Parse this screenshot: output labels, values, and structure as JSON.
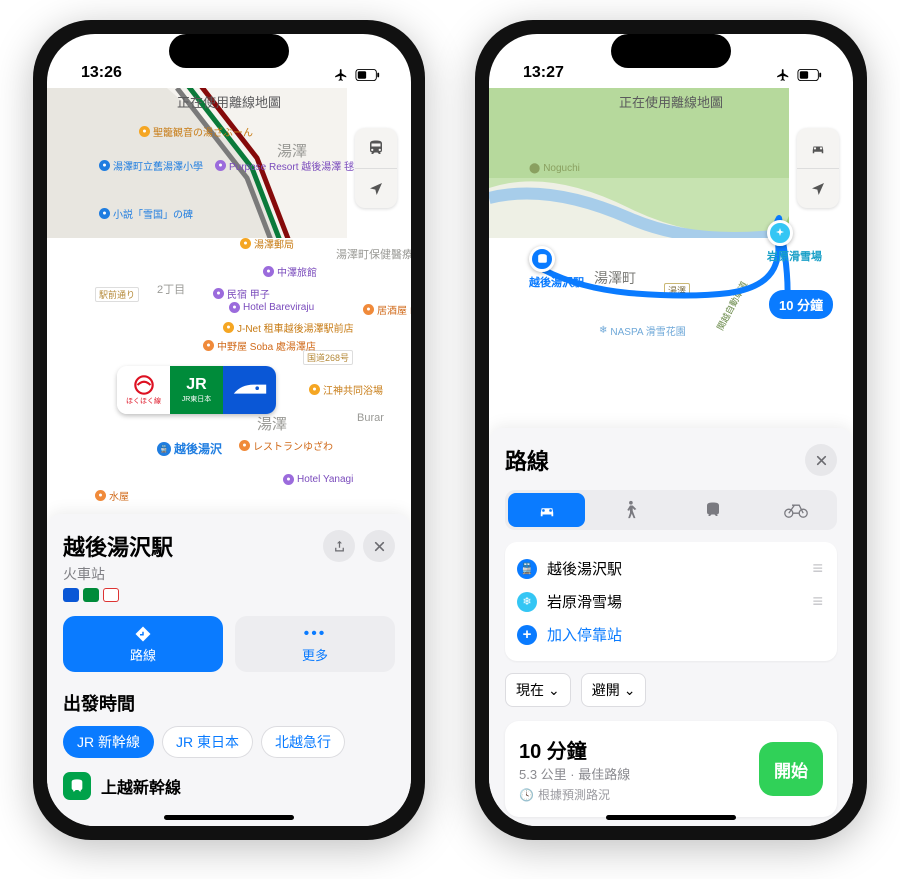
{
  "left": {
    "status_time": "13:26",
    "offline_banner": "正在使用離線地圖",
    "map": {
      "areas": [
        "湯澤",
        "湯澤",
        "2丁目"
      ],
      "station_label": "越後湯沢",
      "roads": [
        "駅前通り",
        "国道268号"
      ],
      "pois": [
        {
          "t": "shop",
          "name": "聖籠観音の湯ざぶーん"
        },
        {
          "t": "transit",
          "name": "湯澤町立舊湯澤小學"
        },
        {
          "t": "hotel",
          "name": "Purpose Resort 越後湯澤 毬"
        },
        {
          "t": "transit",
          "name": "小説「雪国」の碑"
        },
        {
          "t": "shop",
          "name": "湯澤郵局"
        },
        {
          "t": "bld",
          "name": "湯澤町保健醫療"
        },
        {
          "t": "hotel",
          "name": "中澤旅館"
        },
        {
          "t": "hotel",
          "name": "民宿 甲子"
        },
        {
          "t": "hotel",
          "name": "Hotel Bareviraju"
        },
        {
          "t": "food",
          "name": "居酒屋 山新"
        },
        {
          "t": "shop",
          "name": "J-Net 租車越後湯澤駅前店"
        },
        {
          "t": "food",
          "name": "中野屋 Soba 處湯澤店"
        },
        {
          "t": "shop",
          "name": "江神共同浴場"
        },
        {
          "t": "bld",
          "name": "Burar"
        },
        {
          "t": "food",
          "name": "レストランゆざわ"
        },
        {
          "t": "hotel",
          "name": "Hotel Yanagi"
        },
        {
          "t": "food",
          "name": "水屋"
        }
      ],
      "station_card": [
        "ほくほく線",
        "JR東日本",
        ""
      ]
    },
    "sheet": {
      "title": "越後湯沢駅",
      "subtitle": "火車站",
      "actions": {
        "directions": "路線",
        "more": "更多"
      },
      "share_icon": "share-icon",
      "close_icon": "close-icon",
      "departures_heading": "出發時間",
      "chips": [
        "JR 新幹線",
        "JR 東日本",
        "北越急行"
      ],
      "active_chip": 0,
      "line_name": "上越新幹線"
    }
  },
  "right": {
    "status_time": "13:27",
    "offline_banner": "正在使用離線地圖",
    "map": {
      "area": "湯澤町",
      "origin_label": "越後湯沢駅",
      "dest_label": "岩原滑雪場",
      "poi_noguchi": "Noguchi",
      "poi_naspa": "NASPA 滑雪花園",
      "road_shield": "湯澤",
      "expressway": "関越自動車道",
      "eta": "10 分鐘"
    },
    "sheet": {
      "title": "路線",
      "close_icon": "close-icon",
      "modes": [
        "car",
        "walk",
        "transit",
        "bike"
      ],
      "active_mode": 0,
      "stops": {
        "origin": "越後湯沢駅",
        "dest": "岩原滑雪場",
        "add": "加入停靠站"
      },
      "options": {
        "now": "現在",
        "avoid": "避開"
      },
      "route": {
        "duration": "10 分鐘",
        "detail": "5.3 公里 · 最佳路線",
        "note": "根據預測路況",
        "go": "開始"
      }
    }
  }
}
